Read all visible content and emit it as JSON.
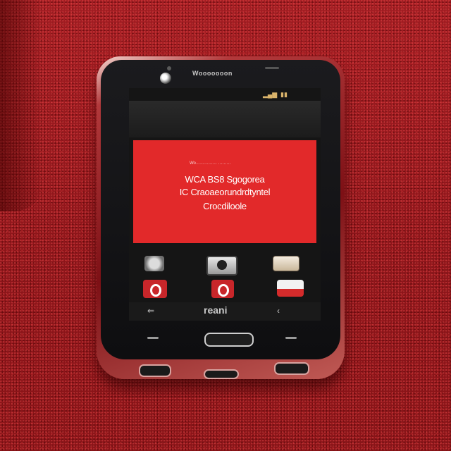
{
  "scene": {
    "description_colors": {
      "carpet": "#9c1a1e",
      "phone_frame": "#7d1015",
      "screen_banner": "#e2292a",
      "bezel": "#0e0e10"
    }
  },
  "phone": {
    "brand_text": "Wooooooon",
    "screen": {
      "banner": {
        "small_text": "Wo…………… ………",
        "line1": "WCA BS8 Sgogorea",
        "line2": "IC Craoaeorundrdtyntel",
        "line3": "Crocdiloole"
      },
      "nav_label": "reani",
      "status_icons": [
        "signal-icon",
        "battery-icon"
      ],
      "apps_row1": [
        "globe-app-icon",
        "camera-app-icon",
        "briefcase-app-icon"
      ],
      "apps_row2": [
        "opera-app-icon",
        "opera-app-icon-2",
        "mail-app-icon"
      ]
    }
  }
}
